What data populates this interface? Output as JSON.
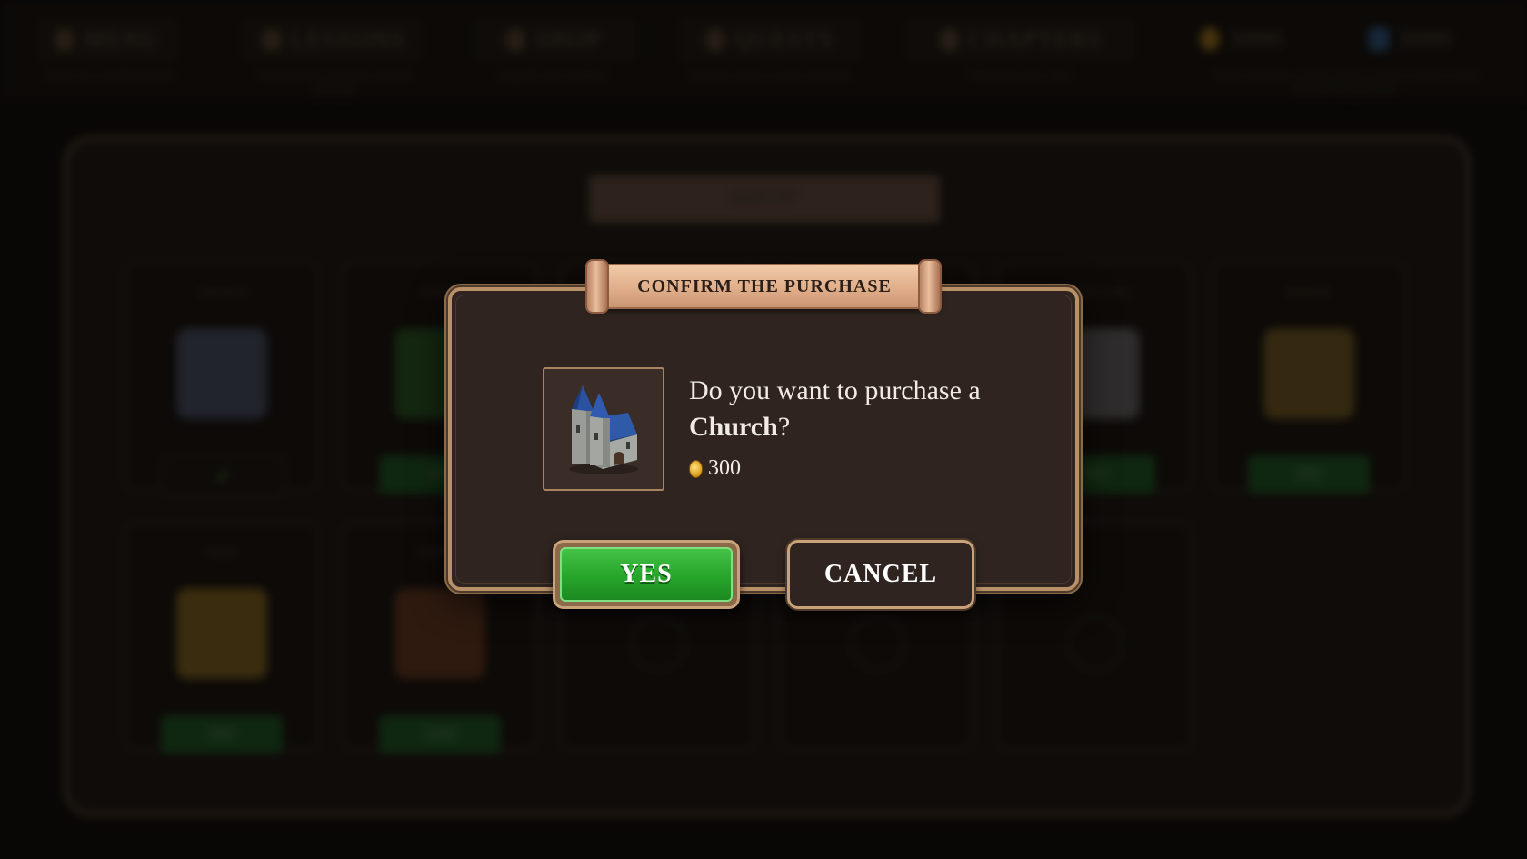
{
  "background": {
    "topbar": [
      {
        "label": "MENU",
        "sub": "Check the overall progress"
      },
      {
        "label": "LESSONS",
        "sub": "Check the list of lessons and the passage"
      },
      {
        "label": "SHOP",
        "sub": "Upgrade your kingdom"
      },
      {
        "label": "QUESTS",
        "sub": "View the quests to gain resources"
      },
      {
        "label": "CHAPTERS",
        "sub": "Follow the game story"
      },
      {
        "label": "3000",
        "sub": ""
      },
      {
        "label": "3000",
        "sub": "Those resources can be spent in shops to build or grow and win the purchase"
      }
    ],
    "shop_title": "SHOP",
    "cards": [
      {
        "name": "CHURCH",
        "price": "",
        "owned": true
      },
      {
        "name": "TOWER",
        "price": "300"
      },
      {
        "name": "",
        "price": ""
      },
      {
        "name": "",
        "price": ""
      },
      {
        "name": "STABLE WALL",
        "price": "300"
      },
      {
        "name": "BAKERY",
        "price": "600"
      },
      {
        "name": "FARM",
        "price": "900"
      },
      {
        "name": "SMITHY",
        "price": "1000"
      },
      {
        "name": "",
        "price": ""
      },
      {
        "name": "",
        "price": ""
      },
      {
        "name": "",
        "price": ""
      }
    ]
  },
  "dialog": {
    "title": "CONFIRM THE PURCHASE",
    "question_prefix": "Do you want to purchase a ",
    "item_name": "Church",
    "question_suffix": "?",
    "price": "300",
    "yes_label": "YES",
    "cancel_label": "CANCEL"
  },
  "colors": {
    "accent_green": "#27a52b",
    "frame_gold": "#b99168",
    "banner_peach": "#e0ae8a",
    "panel_brown": "#2f2420"
  }
}
